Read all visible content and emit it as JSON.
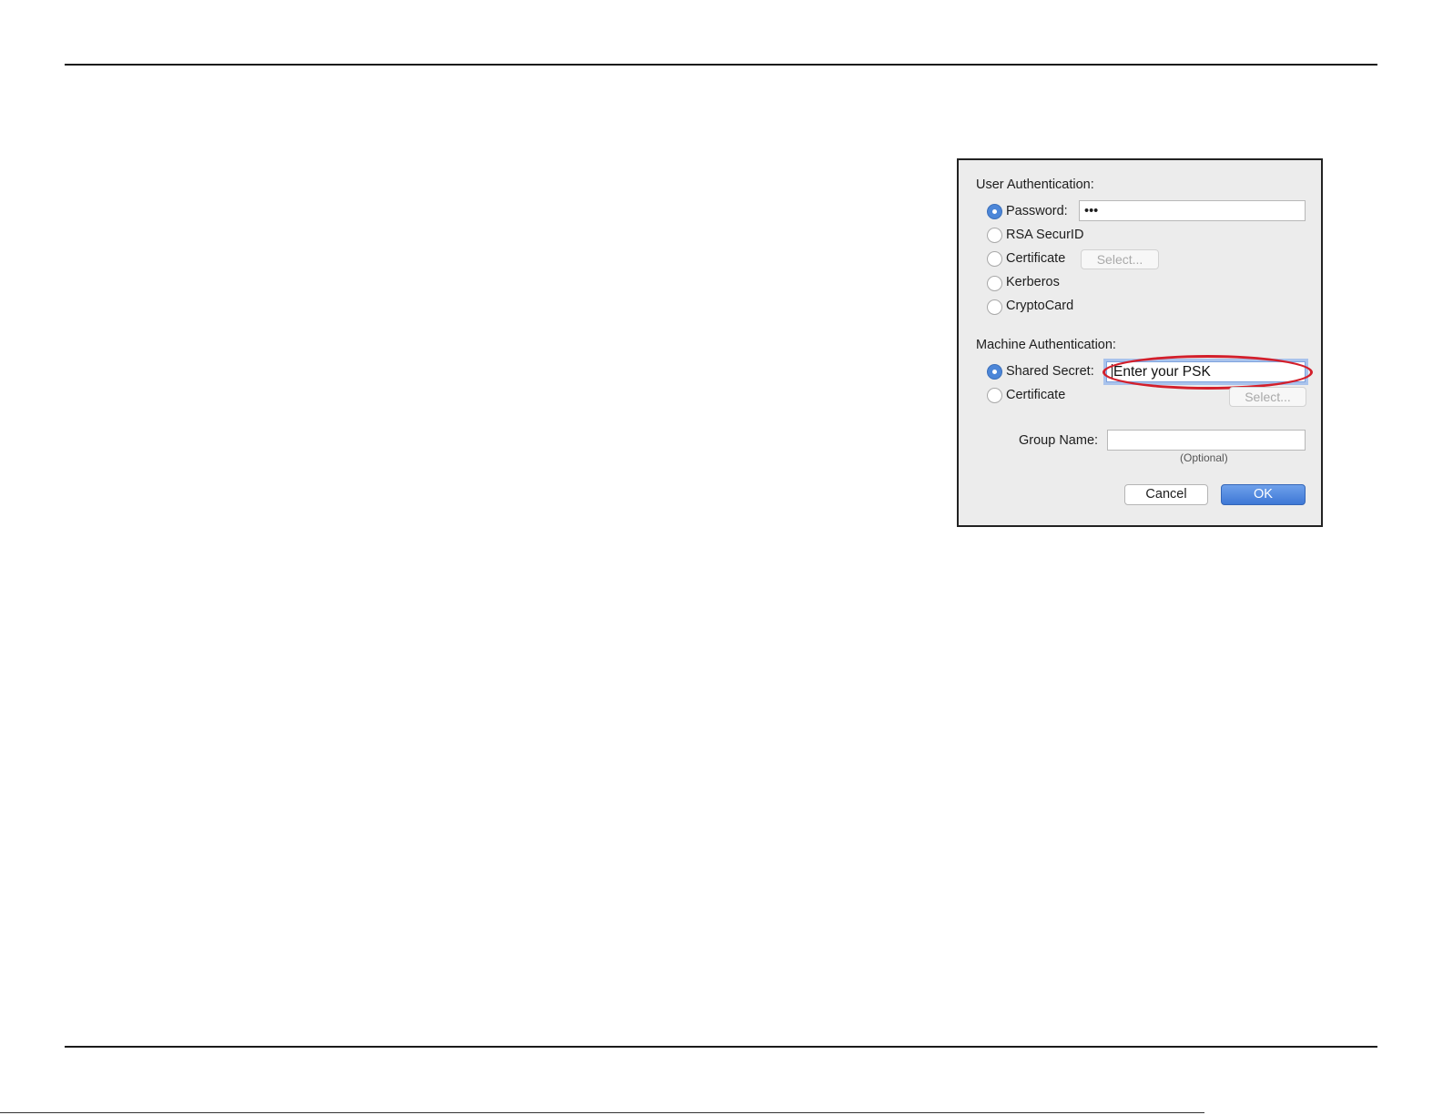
{
  "dialog": {
    "user_auth": {
      "label": "User Authentication:",
      "password_label": "Password:",
      "password_value": "•••",
      "rsa_label": "RSA SecurID",
      "certificate_label": "Certificate",
      "certificate_select": "Select...",
      "kerberos_label": "Kerberos",
      "cryptocard_label": "CryptoCard",
      "selected": "password"
    },
    "machine_auth": {
      "label": "Machine Authentication:",
      "shared_secret_label": "Shared Secret:",
      "shared_secret_value": "Enter your PSK",
      "certificate_label": "Certificate",
      "certificate_select": "Select...",
      "selected": "shared_secret"
    },
    "group": {
      "label": "Group Name:",
      "value": "",
      "hint": "(Optional)"
    },
    "buttons": {
      "cancel": "Cancel",
      "ok": "OK"
    }
  },
  "colors": {
    "accent": "#4c86d8",
    "annotation": "#d31f2b"
  }
}
